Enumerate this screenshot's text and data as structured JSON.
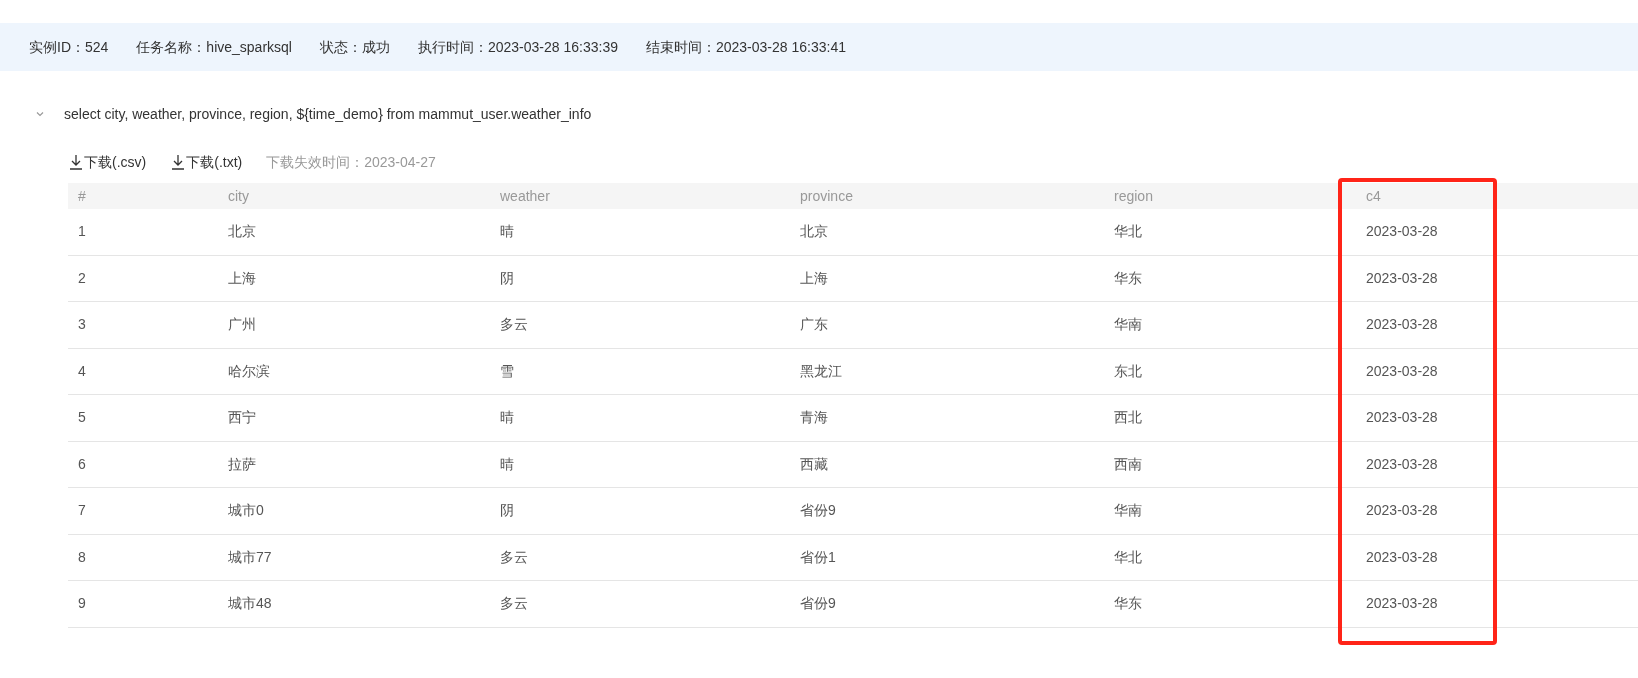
{
  "info_bar": [
    {
      "label": "实例ID：",
      "value": "524"
    },
    {
      "label": "任务名称：",
      "value": "hive_sparksql"
    },
    {
      "label": "状态：",
      "value": "成功"
    },
    {
      "label": "执行时间：",
      "value": "2023-03-28 16:33:39"
    },
    {
      "label": "结束时间：",
      "value": "2023-03-28 16:33:41"
    }
  ],
  "query": {
    "expanded": true,
    "sql": "select city, weather, province, region, ${time_demo} from mammut_user.weather_info"
  },
  "downloads": [
    {
      "label": "下载(.csv)"
    },
    {
      "label": "下载(.txt)"
    }
  ],
  "expiry": "下载失效时间：2023-04-27",
  "table": {
    "columns": [
      {
        "label": "#",
        "highlighted": false
      },
      {
        "label": "city",
        "highlighted": false
      },
      {
        "label": "weather",
        "highlighted": false
      },
      {
        "label": "province",
        "highlighted": false
      },
      {
        "label": "region",
        "highlighted": false
      },
      {
        "label": "c4",
        "highlighted": true
      }
    ],
    "rows": [
      [
        "1",
        "北京",
        "晴",
        "北京",
        "华北",
        "2023-03-28"
      ],
      [
        "2",
        "上海",
        "阴",
        "上海",
        "华东",
        "2023-03-28"
      ],
      [
        "3",
        "广州",
        "多云",
        "广东",
        "华南",
        "2023-03-28"
      ],
      [
        "4",
        "哈尔滨",
        "雪",
        "黑龙江",
        "东北",
        "2023-03-28"
      ],
      [
        "5",
        "西宁",
        "晴",
        "青海",
        "西北",
        "2023-03-28"
      ],
      [
        "6",
        "拉萨",
        "晴",
        "西藏",
        "西南",
        "2023-03-28"
      ],
      [
        "7",
        "城市0",
        "阴",
        "省份9",
        "华南",
        "2023-03-28"
      ],
      [
        "8",
        "城市77",
        "多云",
        "省份1",
        "华北",
        "2023-03-28"
      ],
      [
        "9",
        "城市48",
        "多云",
        "省份9",
        "华东",
        "2023-03-28"
      ]
    ]
  }
}
